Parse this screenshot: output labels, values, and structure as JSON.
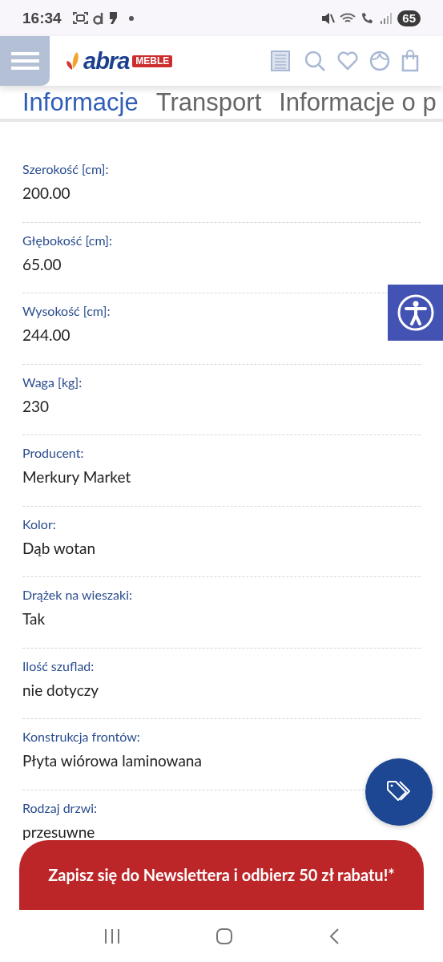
{
  "status_bar": {
    "time": "16:34",
    "battery": "65"
  },
  "header": {
    "logo": "abra",
    "logo_badge": "MEBLE"
  },
  "tabs": [
    {
      "label": "Informacje",
      "selected": true
    },
    {
      "label": "Transport",
      "selected": false
    },
    {
      "label": "Informacje o p",
      "selected": false
    }
  ],
  "specs": [
    {
      "label": "Szerokość [cm]:",
      "value": "200.00"
    },
    {
      "label": "Głębokość [cm]:",
      "value": "65.00"
    },
    {
      "label": "Wysokość [cm]:",
      "value": "244.00"
    },
    {
      "label": "Waga [kg]:",
      "value": "230"
    },
    {
      "label": "Producent:",
      "value": "Merkury Market"
    },
    {
      "label": "Kolor:",
      "value": "Dąb wotan"
    },
    {
      "label": "Drążek na wieszaki:",
      "value": "Tak"
    },
    {
      "label": "Ilość szuflad:",
      "value": "nie dotyczy"
    },
    {
      "label": "Konstrukcja frontów:",
      "value": "Płyta wiórowa laminowana"
    },
    {
      "label": "Rodzaj drzwi:",
      "value": "przesuwne"
    }
  ],
  "newsletter": {
    "text": "Zapisz się do Newslettera i odbierz 50 zł rabatu!*"
  }
}
